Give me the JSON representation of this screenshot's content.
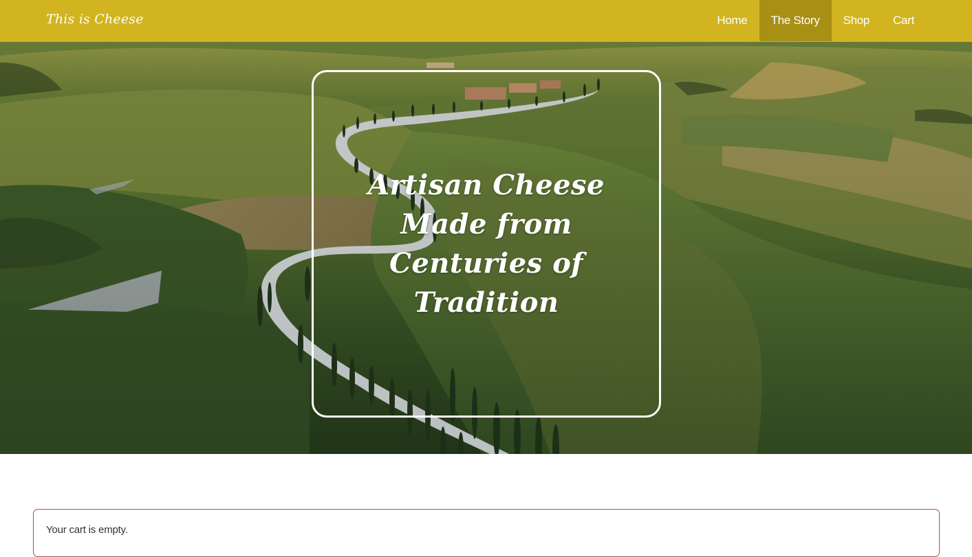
{
  "navbar": {
    "brand": "This is Cheese",
    "links": [
      {
        "label": "Home",
        "active": false
      },
      {
        "label": "The Story",
        "active": true
      },
      {
        "label": "Shop",
        "active": false
      },
      {
        "label": "Cart",
        "active": false
      }
    ]
  },
  "hero": {
    "title_line1": "Artisan Cheese Made from",
    "title_line2": "Centuries of Tradition"
  },
  "cart": {
    "message": "Your cart is empty."
  },
  "colors": {
    "navbar_bg": "#d1b41f",
    "nav_active_bg": "#a89015",
    "cart_border": "#a0524f"
  }
}
